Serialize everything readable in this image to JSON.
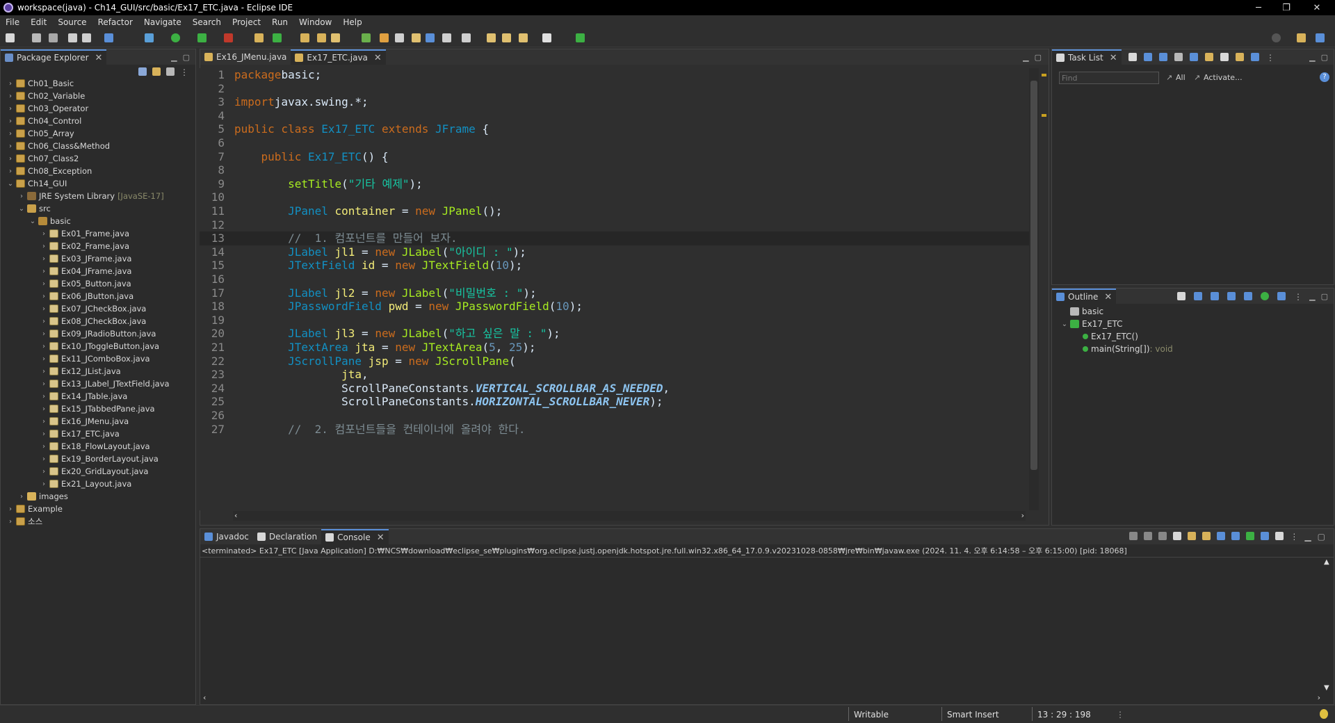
{
  "window": {
    "title": "workspace(java) - Ch14_GUI/src/basic/Ex17_ETC.java - Eclipse IDE",
    "minimize": "─",
    "restore": "❐",
    "close": "✕"
  },
  "menu": [
    "File",
    "Edit",
    "Source",
    "Refactor",
    "Navigate",
    "Search",
    "Project",
    "Run",
    "Window",
    "Help"
  ],
  "package_explorer": {
    "tab_label": "Package Explorer",
    "tree": [
      {
        "label": "Ch01_Basic",
        "depth": 0,
        "toggle": "›",
        "icon": "proj"
      },
      {
        "label": "Ch02_Variable",
        "depth": 0,
        "toggle": "›",
        "icon": "proj"
      },
      {
        "label": "Ch03_Operator",
        "depth": 0,
        "toggle": "›",
        "icon": "proj"
      },
      {
        "label": "Ch04_Control",
        "depth": 0,
        "toggle": "›",
        "icon": "proj"
      },
      {
        "label": "Ch05_Array",
        "depth": 0,
        "toggle": "›",
        "icon": "proj"
      },
      {
        "label": "Ch06_Class&Method",
        "depth": 0,
        "toggle": "›",
        "icon": "proj"
      },
      {
        "label": "Ch07_Class2",
        "depth": 0,
        "toggle": "›",
        "icon": "proj"
      },
      {
        "label": "Ch08_Exception",
        "depth": 0,
        "toggle": "›",
        "icon": "proj"
      },
      {
        "label": "Ch14_GUI",
        "depth": 0,
        "toggle": "⌄",
        "icon": "proj"
      },
      {
        "label": "JRE System Library",
        "extra": "[JavaSE-17]",
        "depth": 1,
        "toggle": "›",
        "icon": "lib"
      },
      {
        "label": "src",
        "depth": 1,
        "toggle": "⌄",
        "icon": "src"
      },
      {
        "label": "basic",
        "depth": 2,
        "toggle": "⌄",
        "icon": "pkg"
      },
      {
        "label": "Ex01_Frame.java",
        "depth": 3,
        "toggle": "›",
        "icon": "java"
      },
      {
        "label": "Ex02_Frame.java",
        "depth": 3,
        "toggle": "›",
        "icon": "java"
      },
      {
        "label": "Ex03_JFrame.java",
        "depth": 3,
        "toggle": "›",
        "icon": "java"
      },
      {
        "label": "Ex04_JFrame.java",
        "depth": 3,
        "toggle": "›",
        "icon": "java"
      },
      {
        "label": "Ex05_Button.java",
        "depth": 3,
        "toggle": "›",
        "icon": "java"
      },
      {
        "label": "Ex06_JButton.java",
        "depth": 3,
        "toggle": "›",
        "icon": "java"
      },
      {
        "label": "Ex07_JCheckBox.java",
        "depth": 3,
        "toggle": "›",
        "icon": "java"
      },
      {
        "label": "Ex08_JCheckBox.java",
        "depth": 3,
        "toggle": "›",
        "icon": "java"
      },
      {
        "label": "Ex09_JRadioButton.java",
        "depth": 3,
        "toggle": "›",
        "icon": "java"
      },
      {
        "label": "Ex10_JToggleButton.java",
        "depth": 3,
        "toggle": "›",
        "icon": "java"
      },
      {
        "label": "Ex11_JComboBox.java",
        "depth": 3,
        "toggle": "›",
        "icon": "java"
      },
      {
        "label": "Ex12_JList.java",
        "depth": 3,
        "toggle": "›",
        "icon": "java"
      },
      {
        "label": "Ex13_JLabel_JTextField.java",
        "depth": 3,
        "toggle": "›",
        "icon": "java"
      },
      {
        "label": "Ex14_JTable.java",
        "depth": 3,
        "toggle": "›",
        "icon": "java"
      },
      {
        "label": "Ex15_JTabbedPane.java",
        "depth": 3,
        "toggle": "›",
        "icon": "java"
      },
      {
        "label": "Ex16_JMenu.java",
        "depth": 3,
        "toggle": "›",
        "icon": "java"
      },
      {
        "label": "Ex17_ETC.java",
        "depth": 3,
        "toggle": "›",
        "icon": "java"
      },
      {
        "label": "Ex18_FlowLayout.java",
        "depth": 3,
        "toggle": "›",
        "icon": "java"
      },
      {
        "label": "Ex19_BorderLayout.java",
        "depth": 3,
        "toggle": "›",
        "icon": "java"
      },
      {
        "label": "Ex20_GridLayout.java",
        "depth": 3,
        "toggle": "›",
        "icon": "java"
      },
      {
        "label": "Ex21_Layout.java",
        "depth": 3,
        "toggle": "›",
        "icon": "java"
      },
      {
        "label": "images",
        "depth": 1,
        "toggle": "›",
        "icon": "fold"
      },
      {
        "label": "Example",
        "depth": 0,
        "toggle": "›",
        "icon": "proj"
      },
      {
        "label": "소스",
        "depth": 0,
        "toggle": "›",
        "icon": "proj"
      }
    ]
  },
  "editor": {
    "tabs": [
      {
        "label": "Ex16_JMenu.java",
        "active": false
      },
      {
        "label": "Ex17_ETC.java",
        "active": true
      }
    ],
    "lines": [
      {
        "n": "1",
        "tokens": [
          [
            "kw",
            "package"
          ],
          [
            "",
            "basic;"
          ]
        ]
      },
      {
        "n": "2",
        "tokens": []
      },
      {
        "n": "3",
        "tokens": [
          [
            "kw",
            "import"
          ],
          [
            "",
            "javax.swing.*;"
          ]
        ]
      },
      {
        "n": "4",
        "tokens": []
      },
      {
        "n": "5",
        "tokens": [
          [
            "kw",
            "public class"
          ],
          [
            "",
            " "
          ],
          [
            "ty",
            "Ex17_ETC"
          ],
          [
            "",
            " "
          ],
          [
            "kw",
            "extends"
          ],
          [
            "",
            " "
          ],
          [
            "ty",
            "JFrame"
          ],
          [
            "",
            " {"
          ]
        ]
      },
      {
        "n": "6",
        "tokens": []
      },
      {
        "n": "7",
        "tokens": [
          [
            "",
            "    "
          ],
          [
            "kw",
            "public"
          ],
          [
            "",
            " "
          ],
          [
            "ty",
            "Ex17_ETC"
          ],
          [
            "",
            "() {"
          ]
        ]
      },
      {
        "n": "8",
        "tokens": []
      },
      {
        "n": "9",
        "tokens": [
          [
            "",
            "        "
          ],
          [
            "fn",
            "setTitle"
          ],
          [
            "",
            "("
          ],
          [
            "st",
            "\"기타 예제\""
          ],
          [
            "",
            ");"
          ]
        ]
      },
      {
        "n": "10",
        "tokens": []
      },
      {
        "n": "11",
        "tokens": [
          [
            "",
            "        "
          ],
          [
            "ty",
            "JPanel"
          ],
          [
            "",
            " "
          ],
          [
            "vr",
            "container"
          ],
          [
            "",
            " = "
          ],
          [
            "kw",
            "new"
          ],
          [
            "",
            " "
          ],
          [
            "fn",
            "JPanel"
          ],
          [
            "",
            "();"
          ]
        ]
      },
      {
        "n": "12",
        "tokens": []
      },
      {
        "n": "13",
        "tokens": [
          [
            "",
            "        "
          ],
          [
            "cm",
            "//  1. 컴포넌트를 만들어 보자."
          ]
        ]
      },
      {
        "n": "14",
        "tokens": [
          [
            "",
            "        "
          ],
          [
            "ty",
            "JLabel"
          ],
          [
            "",
            " "
          ],
          [
            "vr",
            "jl1"
          ],
          [
            "",
            " = "
          ],
          [
            "kw",
            "new"
          ],
          [
            "",
            " "
          ],
          [
            "fn",
            "JLabel"
          ],
          [
            "",
            "("
          ],
          [
            "st",
            "\"아이디 : \""
          ],
          [
            "",
            ");"
          ]
        ]
      },
      {
        "n": "15",
        "tokens": [
          [
            "",
            "        "
          ],
          [
            "ty",
            "JTextField"
          ],
          [
            "",
            " "
          ],
          [
            "vr",
            "id"
          ],
          [
            "",
            " = "
          ],
          [
            "kw",
            "new"
          ],
          [
            "",
            " "
          ],
          [
            "fn",
            "JTextField"
          ],
          [
            "",
            "("
          ],
          [
            "nm",
            "10"
          ],
          [
            "",
            ");"
          ]
        ]
      },
      {
        "n": "16",
        "tokens": []
      },
      {
        "n": "17",
        "tokens": [
          [
            "",
            "        "
          ],
          [
            "ty",
            "JLabel"
          ],
          [
            "",
            " "
          ],
          [
            "vr",
            "jl2"
          ],
          [
            "",
            " = "
          ],
          [
            "kw",
            "new"
          ],
          [
            "",
            " "
          ],
          [
            "fn",
            "JLabel"
          ],
          [
            "",
            "("
          ],
          [
            "st",
            "\"비밀번호 : \""
          ],
          [
            "",
            ");"
          ]
        ]
      },
      {
        "n": "18",
        "tokens": [
          [
            "",
            "        "
          ],
          [
            "ty",
            "JPasswordField"
          ],
          [
            "",
            " "
          ],
          [
            "vr",
            "pwd"
          ],
          [
            "",
            " = "
          ],
          [
            "kw",
            "new"
          ],
          [
            "",
            " "
          ],
          [
            "fn",
            "JPasswordField"
          ],
          [
            "",
            "("
          ],
          [
            "nm",
            "10"
          ],
          [
            "",
            ");"
          ]
        ]
      },
      {
        "n": "19",
        "tokens": []
      },
      {
        "n": "20",
        "tokens": [
          [
            "",
            "        "
          ],
          [
            "ty",
            "JLabel"
          ],
          [
            "",
            " "
          ],
          [
            "vr",
            "jl3"
          ],
          [
            "",
            " = "
          ],
          [
            "kw",
            "new"
          ],
          [
            "",
            " "
          ],
          [
            "fn",
            "JLabel"
          ],
          [
            "",
            "("
          ],
          [
            "st",
            "\"하고 싶은 말 : \""
          ],
          [
            "",
            ");"
          ]
        ]
      },
      {
        "n": "21",
        "tokens": [
          [
            "",
            "        "
          ],
          [
            "ty",
            "JTextArea"
          ],
          [
            "",
            " "
          ],
          [
            "vr",
            "jta"
          ],
          [
            "",
            " = "
          ],
          [
            "kw",
            "new"
          ],
          [
            "",
            " "
          ],
          [
            "fn",
            "JTextArea"
          ],
          [
            "",
            "("
          ],
          [
            "nm",
            "5"
          ],
          [
            "",
            ", "
          ],
          [
            "nm",
            "25"
          ],
          [
            "",
            ");"
          ]
        ]
      },
      {
        "n": "22",
        "tokens": [
          [
            "",
            "        "
          ],
          [
            "ty",
            "JScrollPane"
          ],
          [
            "",
            " "
          ],
          [
            "vr",
            "jsp"
          ],
          [
            "",
            " = "
          ],
          [
            "kw",
            "new"
          ],
          [
            "",
            " "
          ],
          [
            "fn",
            "JScrollPane"
          ],
          [
            "",
            "("
          ]
        ]
      },
      {
        "n": "23",
        "tokens": [
          [
            "",
            "                "
          ],
          [
            "vr",
            "jta"
          ],
          [
            "",
            ","
          ]
        ]
      },
      {
        "n": "24",
        "tokens": [
          [
            "",
            "                "
          ],
          [
            "",
            "ScrollPaneConstants."
          ],
          [
            "cn",
            "VERTICAL_SCROLLBAR_AS_NEEDED"
          ],
          [
            "",
            ","
          ]
        ]
      },
      {
        "n": "25",
        "tokens": [
          [
            "",
            "                "
          ],
          [
            "",
            "ScrollPaneConstants."
          ],
          [
            "cn",
            "HORIZONTAL_SCROLLBAR_NEVER"
          ],
          [
            "",
            ");"
          ]
        ]
      },
      {
        "n": "26",
        "tokens": []
      },
      {
        "n": "27",
        "tokens": [
          [
            "",
            "        "
          ],
          [
            "cm",
            "//  2. 컴포넌트들을 컨테이너에 올려야 한다."
          ]
        ]
      }
    ]
  },
  "task_list": {
    "tab_label": "Task List",
    "find_placeholder": "Find",
    "all_label": "All",
    "activate_label": "Activate..."
  },
  "outline": {
    "tab_label": "Outline",
    "items": [
      {
        "label": "basic",
        "depth": 0,
        "toggle": "",
        "extra": ""
      },
      {
        "label": "Ex17_ETC",
        "depth": 0,
        "toggle": "⌄",
        "extra": ""
      },
      {
        "label": "Ex17_ETC()",
        "depth": 1,
        "toggle": "",
        "extra": ""
      },
      {
        "label": "main(String[])",
        "depth": 1,
        "toggle": "",
        "extra": " : void"
      }
    ]
  },
  "bottom": {
    "tabs": [
      {
        "label": "Javadoc",
        "active": false
      },
      {
        "label": "Declaration",
        "active": false
      },
      {
        "label": "Console",
        "active": true
      }
    ],
    "console_status": "<terminated> Ex17_ETC [Java Application] D:₩NCS₩download₩eclipse_se₩plugins₩org.eclipse.justj.openjdk.hotspot.jre.full.win32.x86_64_17.0.9.v20231028-0858₩jre₩bin₩javaw.exe  (2024. 11. 4. 오후 6:14:58 – 오후 6:15:00) [pid: 18068]"
  },
  "status": {
    "writable": "Writable",
    "insert_mode": "Smart Insert",
    "position": "13 : 29 : 198"
  }
}
